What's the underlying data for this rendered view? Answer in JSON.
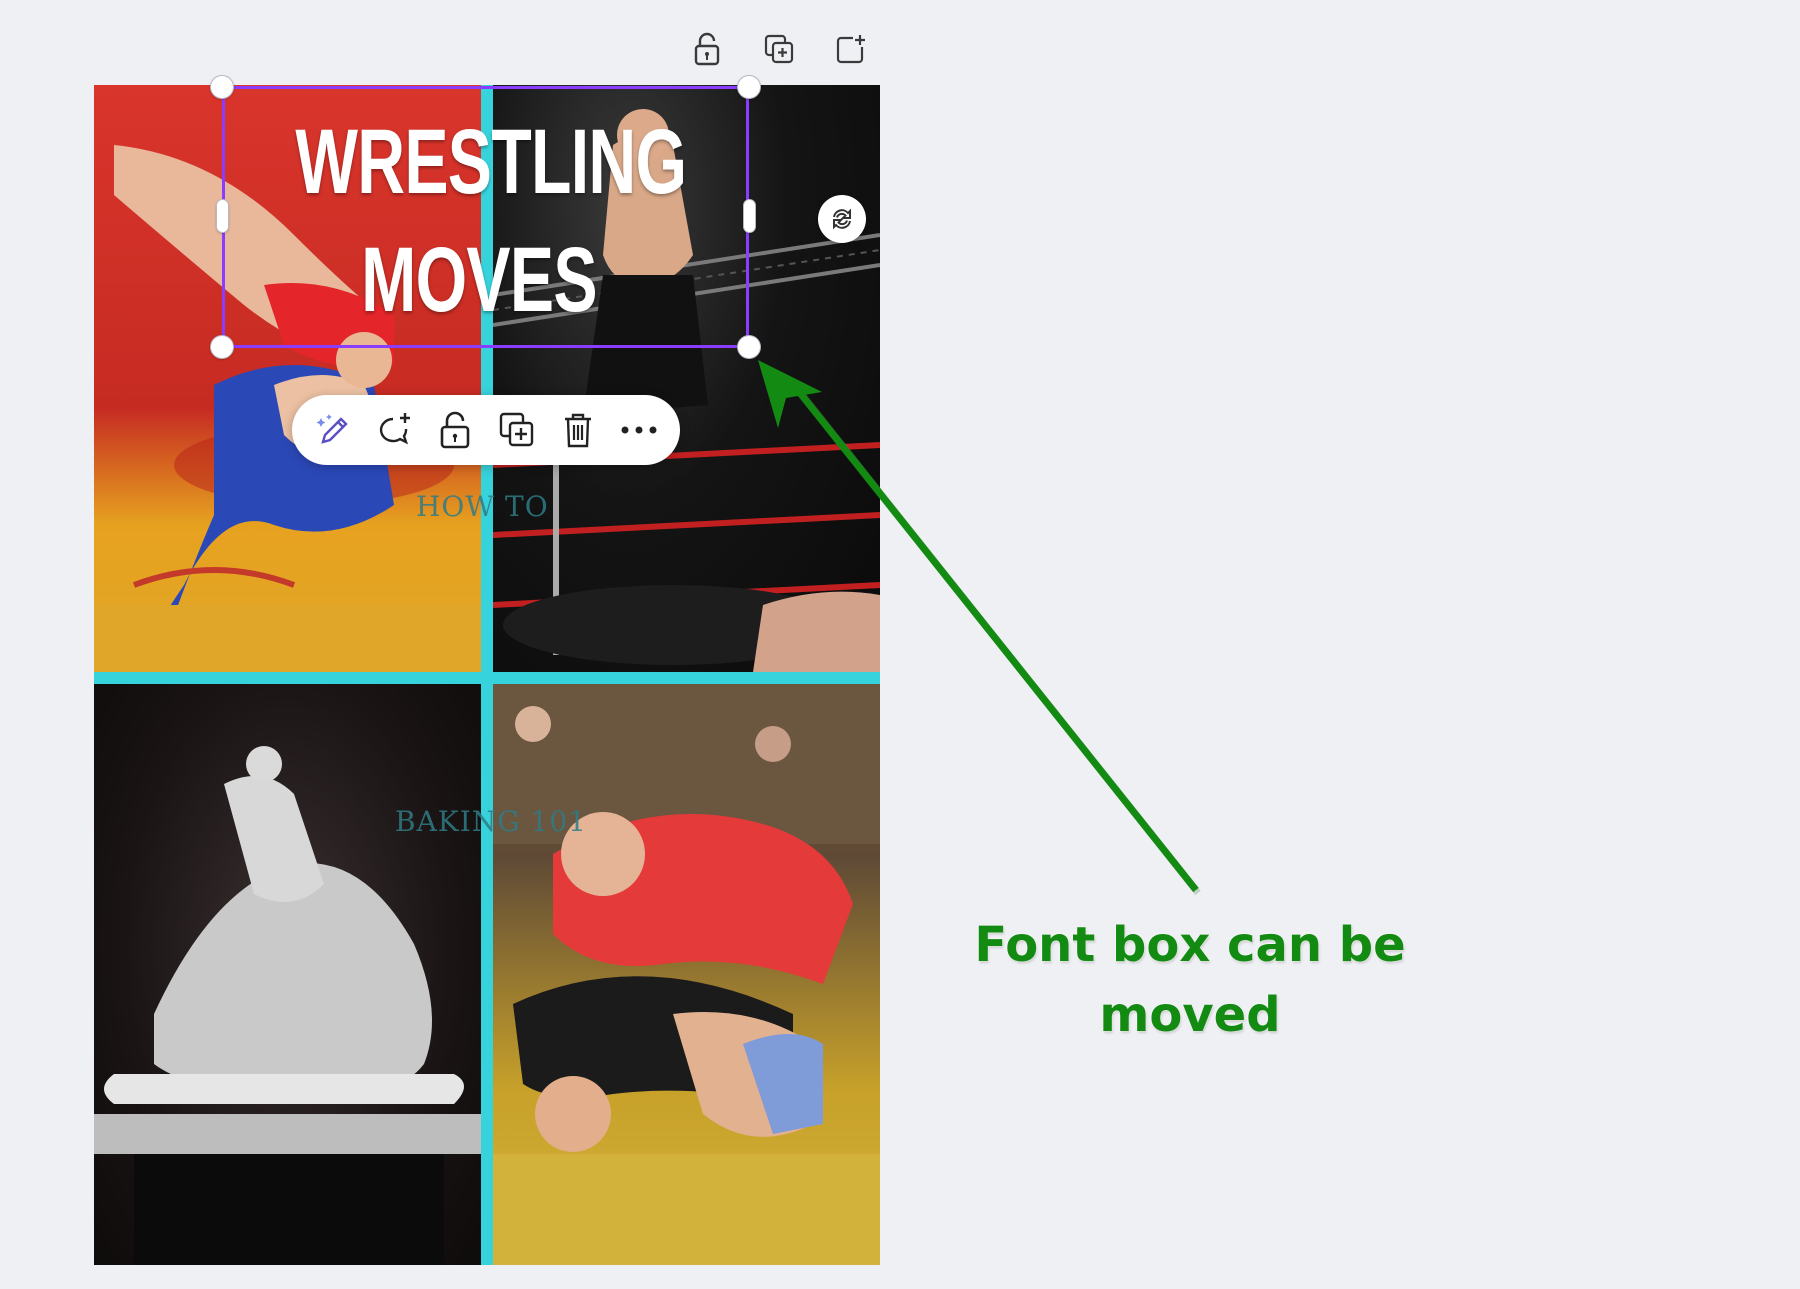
{
  "design": {
    "title": "WRESTLING MOVES",
    "subtext_1": "HOW TO",
    "subtext_2": "BAKING 101"
  },
  "annotation": {
    "text": "Font box can be moved",
    "color": "#138a12"
  },
  "page_actions": [
    {
      "name": "lock-icon"
    },
    {
      "name": "duplicate-page-icon"
    },
    {
      "name": "add-page-icon"
    }
  ],
  "element_toolbar": [
    {
      "name": "magic-write-icon"
    },
    {
      "name": "add-comment-icon"
    },
    {
      "name": "lock-icon"
    },
    {
      "name": "duplicate-icon"
    },
    {
      "name": "delete-icon"
    },
    {
      "name": "more-options-icon"
    }
  ],
  "colors": {
    "selection": "#8b3dff",
    "grid_spacing": "#37d3dd",
    "background": "#eff0f4"
  }
}
